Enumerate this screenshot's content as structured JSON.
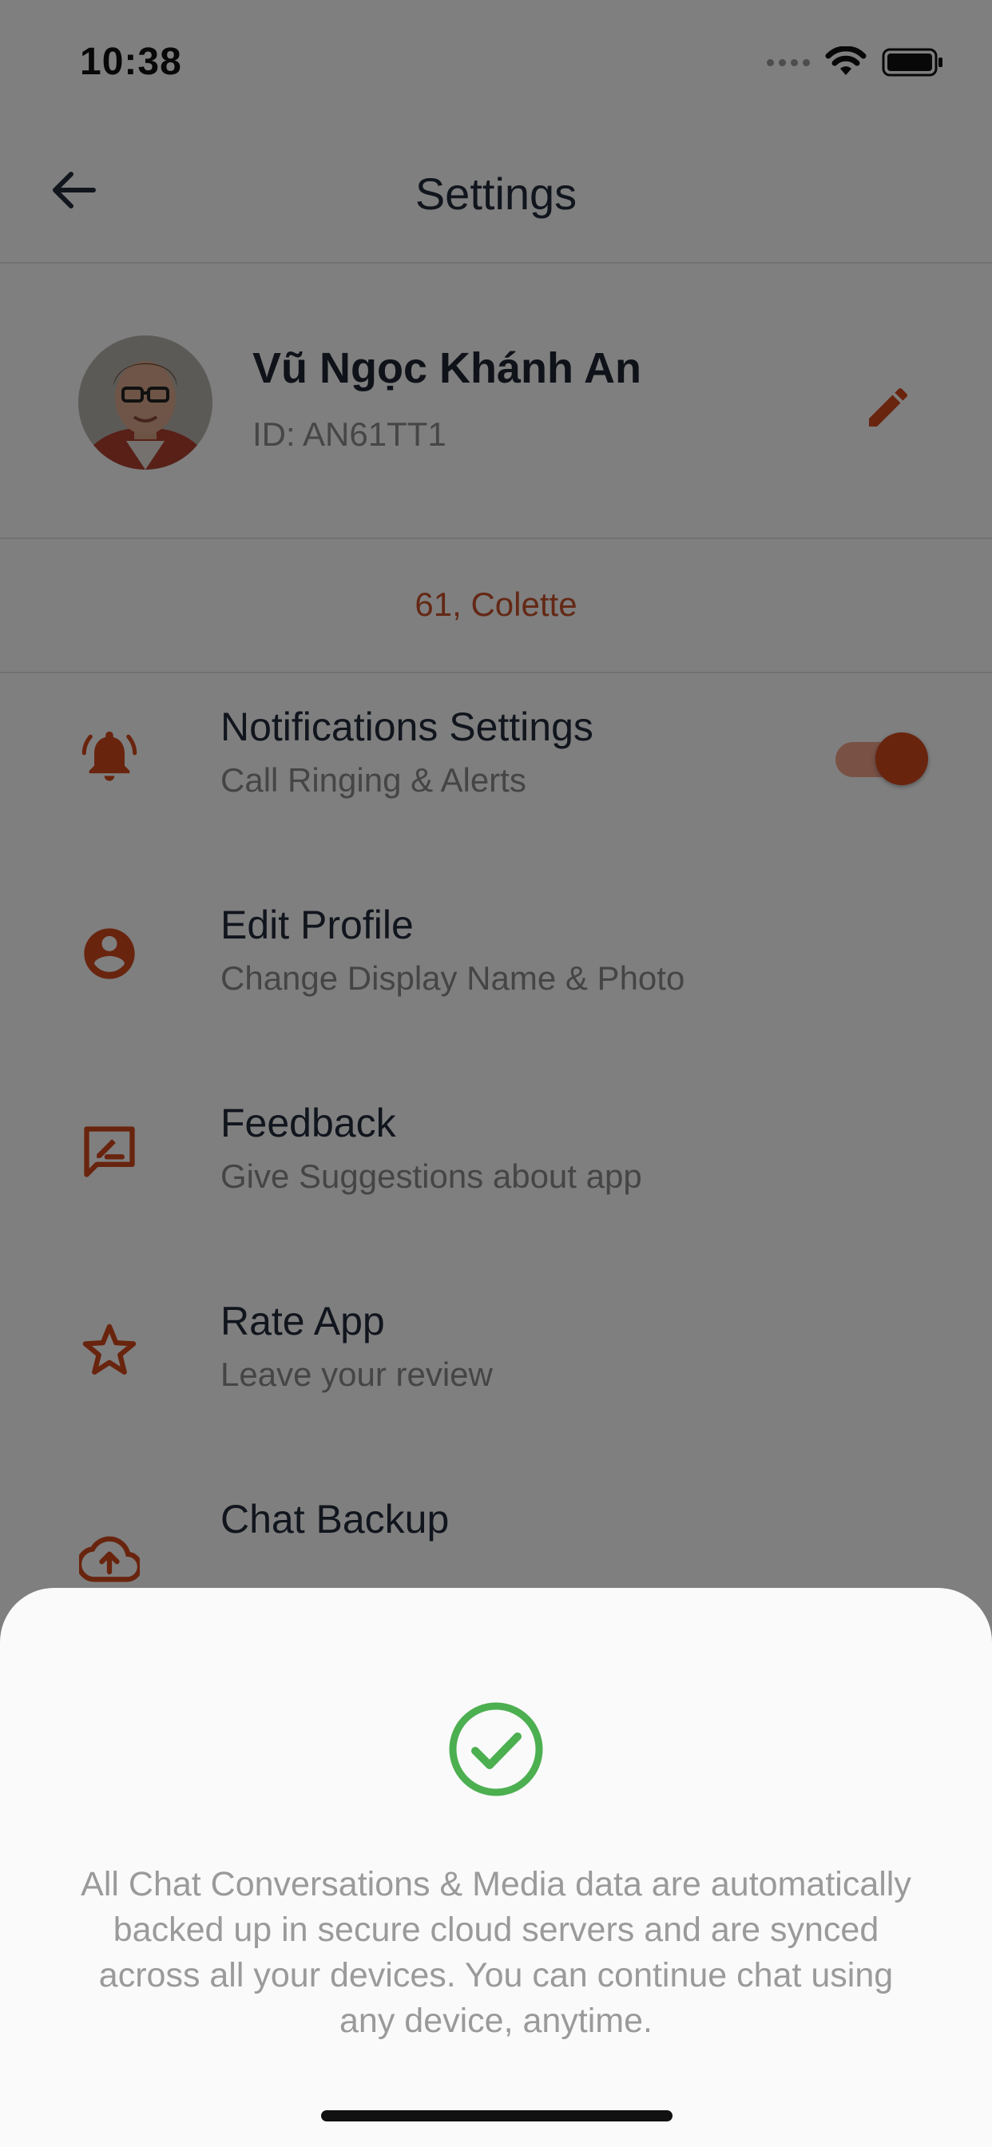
{
  "status_bar": {
    "time": "10:38"
  },
  "header": {
    "title": "Settings"
  },
  "profile": {
    "name": "Vũ Ngọc Khánh An",
    "id_text": "ID: AN61TT1"
  },
  "location": "61, Colette",
  "menu": [
    {
      "title": "Notifications Settings",
      "subtitle": "Call Ringing & Alerts",
      "icon": "bell-icon",
      "toggle_on": true
    },
    {
      "title": "Edit Profile",
      "subtitle": "Change Display Name & Photo",
      "icon": "account-circle-icon"
    },
    {
      "title": "Feedback",
      "subtitle": "Give Suggestions about app",
      "icon": "feedback-icon"
    },
    {
      "title": "Rate App",
      "subtitle": "Leave your review",
      "icon": "star-icon"
    },
    {
      "title": "Chat Backup",
      "subtitle": "",
      "icon": "cloud-upload-icon"
    }
  ],
  "sheet": {
    "message": "All Chat Conversations & Media data are automatically backed up in secure cloud servers and are synced across all your devices. You can continue chat using any device, anytime.",
    "icon": "check-circle-icon"
  },
  "colors": {
    "accent": "#d2481d",
    "success": "#4caf50",
    "text_dark": "#222a3a",
    "text_muted": "#8b8b8b"
  }
}
